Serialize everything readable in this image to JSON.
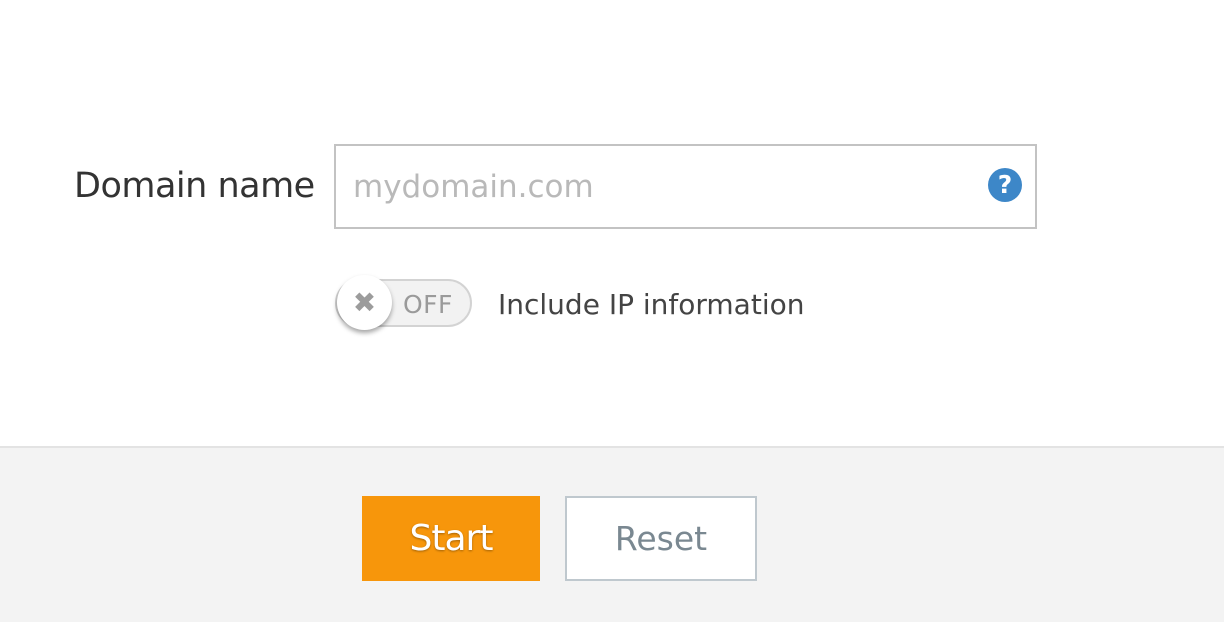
{
  "form": {
    "domain_label": "Domain name",
    "domain_input": {
      "value": "",
      "placeholder": "mydomain.com"
    },
    "help_icon": {
      "name": "help-icon",
      "glyph": "?",
      "color": "#3d87c8"
    },
    "ip_toggle": {
      "state_label": "OFF",
      "knob_glyph": "✖",
      "checked": false,
      "label": "Include IP information"
    }
  },
  "footer": {
    "start_label": "Start",
    "reset_label": "Reset"
  },
  "colors": {
    "accent": "#f7960b",
    "footer_bg": "#f3f3f3",
    "reset_text": "#7a8891"
  }
}
